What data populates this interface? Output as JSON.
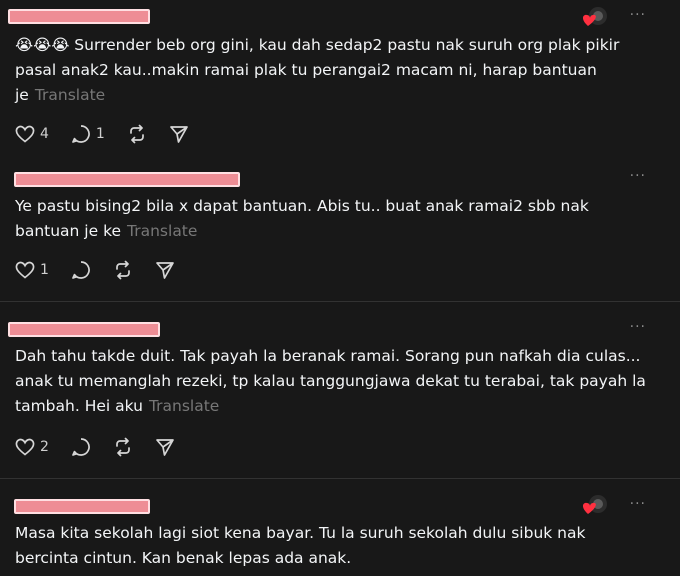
{
  "posts": [
    {
      "text": "Surrender beb org gini, kau dah sedap2 pastu nak suruh org plak pikir pasal anak2 kau..makin ramai plak tu perangai2 macam ni, harap bantuan je",
      "emoji_prefix": "😭😭😭",
      "translate": "Translate",
      "likes": "4",
      "replies": "1",
      "liked_by_author": true
    },
    {
      "text": "Ye pastu bising2 bila x dapat bantuan. Abis tu.. buat anak ramai2 sbb nak bantuan je ke",
      "translate": "Translate",
      "likes": "1",
      "replies": "",
      "liked_by_author": false
    },
    {
      "text": "Dah tahu takde duit. Tak payah la beranak ramai. Sorang pun nafkah dia culas... anak tu memanglah rezeki, tp kalau tanggungjawa dekat tu terabai, tak payah la tambah. Hei aku",
      "translate": "Translate",
      "likes": "2",
      "replies": "",
      "liked_by_author": false
    },
    {
      "text": "Masa kita sekolah lagi siot kena bayar. Tu la suruh sekolah dulu sibuk nak bercinta cintun. Kan benak lepas ada anak.",
      "liked_by_author": true
    }
  ],
  "more_label": "···",
  "icons": {
    "like": "heart-outline-icon",
    "reply": "comment-bubble-icon",
    "repost": "repost-icon",
    "share": "send-paper-plane-icon",
    "liked_by_author": "red-heart-avatar-icon"
  },
  "colors": {
    "background": "#181818",
    "redaction": "#ee8d95",
    "muted": "#777777"
  }
}
